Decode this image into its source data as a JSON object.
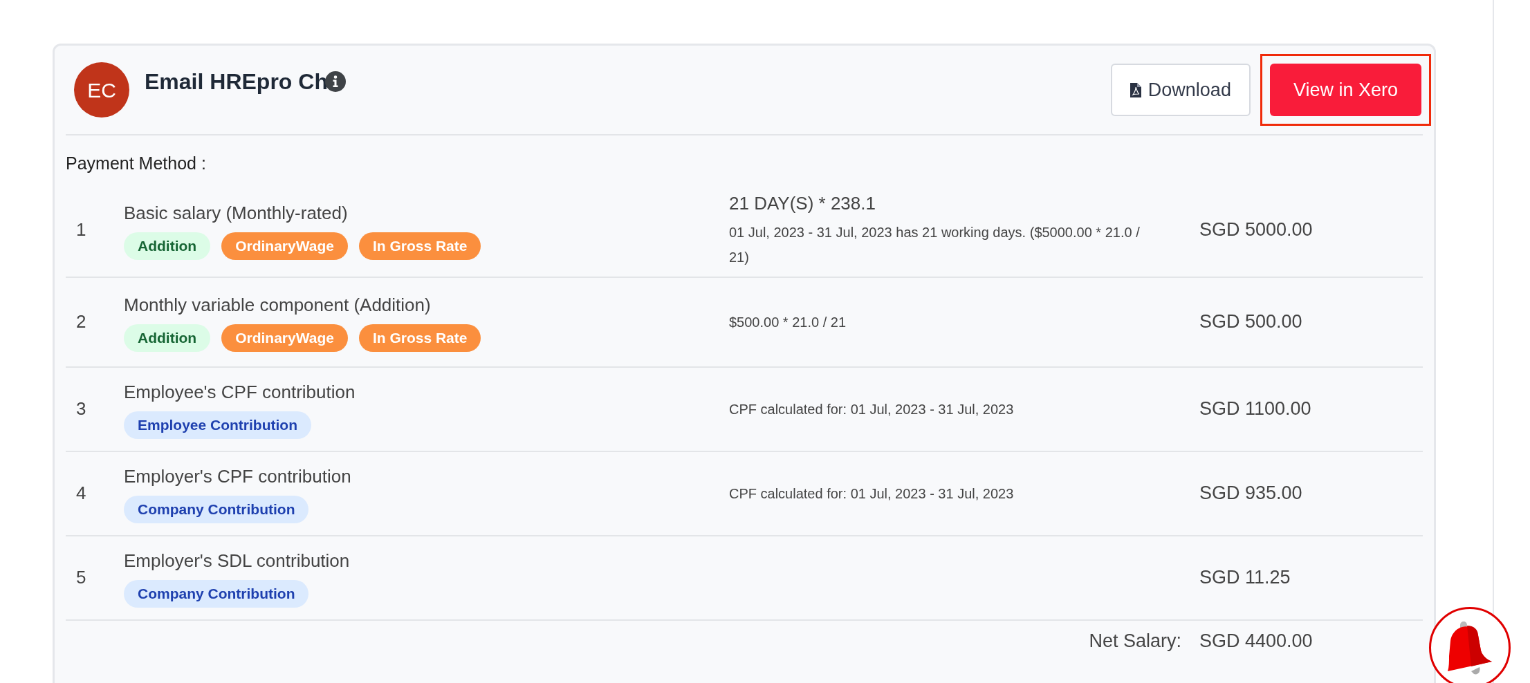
{
  "header": {
    "avatar_initials": "EC",
    "title": "Email HREpro Ch",
    "buttons": [
      {
        "label": "Download",
        "kind": "download",
        "highlighted": false
      },
      {
        "label": "View in Xero",
        "kind": "primary",
        "highlighted": true
      }
    ]
  },
  "payment_method_label": "Payment Method :",
  "items": [
    {
      "number": "1",
      "name": "Basic salary (Monthly-rated)",
      "tags": [
        {
          "label": "Addition",
          "kind": "addition"
        },
        {
          "label": "OrdinaryWage",
          "kind": "wage"
        },
        {
          "label": "In Gross Rate",
          "kind": "wage"
        }
      ],
      "calculation": "21 DAY(S) * 238.1",
      "detail": "01 Jul, 2023 - 31 Jul, 2023 has 21 working days. ($5000.00 * 21.0 / 21)",
      "amount": "SGD 5000.00"
    },
    {
      "number": "2",
      "name": "Monthly variable component (Addition)",
      "tags": [
        {
          "label": "Addition",
          "kind": "addition"
        },
        {
          "label": "OrdinaryWage",
          "kind": "wage"
        },
        {
          "label": "In Gross Rate",
          "kind": "wage"
        }
      ],
      "detail": "$500.00 * 21.0 / 21",
      "amount": "SGD 500.00"
    },
    {
      "number": "3",
      "name": "Employee's CPF contribution",
      "tags": [
        {
          "label": "Employee Contribution",
          "kind": "contribution"
        }
      ],
      "detail": "CPF calculated for: 01 Jul, 2023 - 31 Jul, 2023",
      "amount": "SGD 1100.00"
    },
    {
      "number": "4",
      "name": "Employer's CPF contribution",
      "tags": [
        {
          "label": "Company Contribution",
          "kind": "contribution"
        }
      ],
      "detail": "CPF calculated for: 01 Jul, 2023 - 31 Jul, 2023",
      "amount": "SGD 935.00"
    },
    {
      "number": "5",
      "name": "Employer's SDL contribution",
      "tags": [
        {
          "label": "Company Contribution",
          "kind": "contribution"
        }
      ],
      "amount": "SGD 11.25"
    }
  ],
  "net_salary": {
    "label": "Net Salary:",
    "amount": "SGD 4400.00"
  }
}
